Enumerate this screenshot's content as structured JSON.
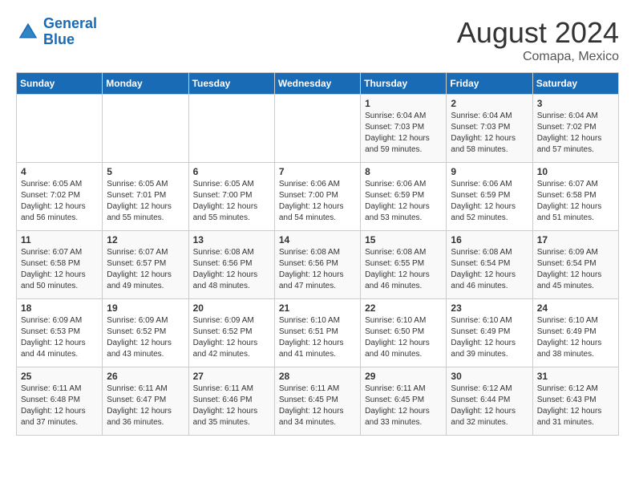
{
  "header": {
    "logo_line1": "General",
    "logo_line2": "Blue",
    "month_year": "August 2024",
    "location": "Comapa, Mexico"
  },
  "days_of_week": [
    "Sunday",
    "Monday",
    "Tuesday",
    "Wednesday",
    "Thursday",
    "Friday",
    "Saturday"
  ],
  "weeks": [
    [
      {
        "day": "",
        "info": ""
      },
      {
        "day": "",
        "info": ""
      },
      {
        "day": "",
        "info": ""
      },
      {
        "day": "",
        "info": ""
      },
      {
        "day": "1",
        "info": "Sunrise: 6:04 AM\nSunset: 7:03 PM\nDaylight: 12 hours\nand 59 minutes."
      },
      {
        "day": "2",
        "info": "Sunrise: 6:04 AM\nSunset: 7:03 PM\nDaylight: 12 hours\nand 58 minutes."
      },
      {
        "day": "3",
        "info": "Sunrise: 6:04 AM\nSunset: 7:02 PM\nDaylight: 12 hours\nand 57 minutes."
      }
    ],
    [
      {
        "day": "4",
        "info": "Sunrise: 6:05 AM\nSunset: 7:02 PM\nDaylight: 12 hours\nand 56 minutes."
      },
      {
        "day": "5",
        "info": "Sunrise: 6:05 AM\nSunset: 7:01 PM\nDaylight: 12 hours\nand 55 minutes."
      },
      {
        "day": "6",
        "info": "Sunrise: 6:05 AM\nSunset: 7:00 PM\nDaylight: 12 hours\nand 55 minutes."
      },
      {
        "day": "7",
        "info": "Sunrise: 6:06 AM\nSunset: 7:00 PM\nDaylight: 12 hours\nand 54 minutes."
      },
      {
        "day": "8",
        "info": "Sunrise: 6:06 AM\nSunset: 6:59 PM\nDaylight: 12 hours\nand 53 minutes."
      },
      {
        "day": "9",
        "info": "Sunrise: 6:06 AM\nSunset: 6:59 PM\nDaylight: 12 hours\nand 52 minutes."
      },
      {
        "day": "10",
        "info": "Sunrise: 6:07 AM\nSunset: 6:58 PM\nDaylight: 12 hours\nand 51 minutes."
      }
    ],
    [
      {
        "day": "11",
        "info": "Sunrise: 6:07 AM\nSunset: 6:58 PM\nDaylight: 12 hours\nand 50 minutes."
      },
      {
        "day": "12",
        "info": "Sunrise: 6:07 AM\nSunset: 6:57 PM\nDaylight: 12 hours\nand 49 minutes."
      },
      {
        "day": "13",
        "info": "Sunrise: 6:08 AM\nSunset: 6:56 PM\nDaylight: 12 hours\nand 48 minutes."
      },
      {
        "day": "14",
        "info": "Sunrise: 6:08 AM\nSunset: 6:56 PM\nDaylight: 12 hours\nand 47 minutes."
      },
      {
        "day": "15",
        "info": "Sunrise: 6:08 AM\nSunset: 6:55 PM\nDaylight: 12 hours\nand 46 minutes."
      },
      {
        "day": "16",
        "info": "Sunrise: 6:08 AM\nSunset: 6:54 PM\nDaylight: 12 hours\nand 46 minutes."
      },
      {
        "day": "17",
        "info": "Sunrise: 6:09 AM\nSunset: 6:54 PM\nDaylight: 12 hours\nand 45 minutes."
      }
    ],
    [
      {
        "day": "18",
        "info": "Sunrise: 6:09 AM\nSunset: 6:53 PM\nDaylight: 12 hours\nand 44 minutes."
      },
      {
        "day": "19",
        "info": "Sunrise: 6:09 AM\nSunset: 6:52 PM\nDaylight: 12 hours\nand 43 minutes."
      },
      {
        "day": "20",
        "info": "Sunrise: 6:09 AM\nSunset: 6:52 PM\nDaylight: 12 hours\nand 42 minutes."
      },
      {
        "day": "21",
        "info": "Sunrise: 6:10 AM\nSunset: 6:51 PM\nDaylight: 12 hours\nand 41 minutes."
      },
      {
        "day": "22",
        "info": "Sunrise: 6:10 AM\nSunset: 6:50 PM\nDaylight: 12 hours\nand 40 minutes."
      },
      {
        "day": "23",
        "info": "Sunrise: 6:10 AM\nSunset: 6:49 PM\nDaylight: 12 hours\nand 39 minutes."
      },
      {
        "day": "24",
        "info": "Sunrise: 6:10 AM\nSunset: 6:49 PM\nDaylight: 12 hours\nand 38 minutes."
      }
    ],
    [
      {
        "day": "25",
        "info": "Sunrise: 6:11 AM\nSunset: 6:48 PM\nDaylight: 12 hours\nand 37 minutes."
      },
      {
        "day": "26",
        "info": "Sunrise: 6:11 AM\nSunset: 6:47 PM\nDaylight: 12 hours\nand 36 minutes."
      },
      {
        "day": "27",
        "info": "Sunrise: 6:11 AM\nSunset: 6:46 PM\nDaylight: 12 hours\nand 35 minutes."
      },
      {
        "day": "28",
        "info": "Sunrise: 6:11 AM\nSunset: 6:45 PM\nDaylight: 12 hours\nand 34 minutes."
      },
      {
        "day": "29",
        "info": "Sunrise: 6:11 AM\nSunset: 6:45 PM\nDaylight: 12 hours\nand 33 minutes."
      },
      {
        "day": "30",
        "info": "Sunrise: 6:12 AM\nSunset: 6:44 PM\nDaylight: 12 hours\nand 32 minutes."
      },
      {
        "day": "31",
        "info": "Sunrise: 6:12 AM\nSunset: 6:43 PM\nDaylight: 12 hours\nand 31 minutes."
      }
    ]
  ]
}
